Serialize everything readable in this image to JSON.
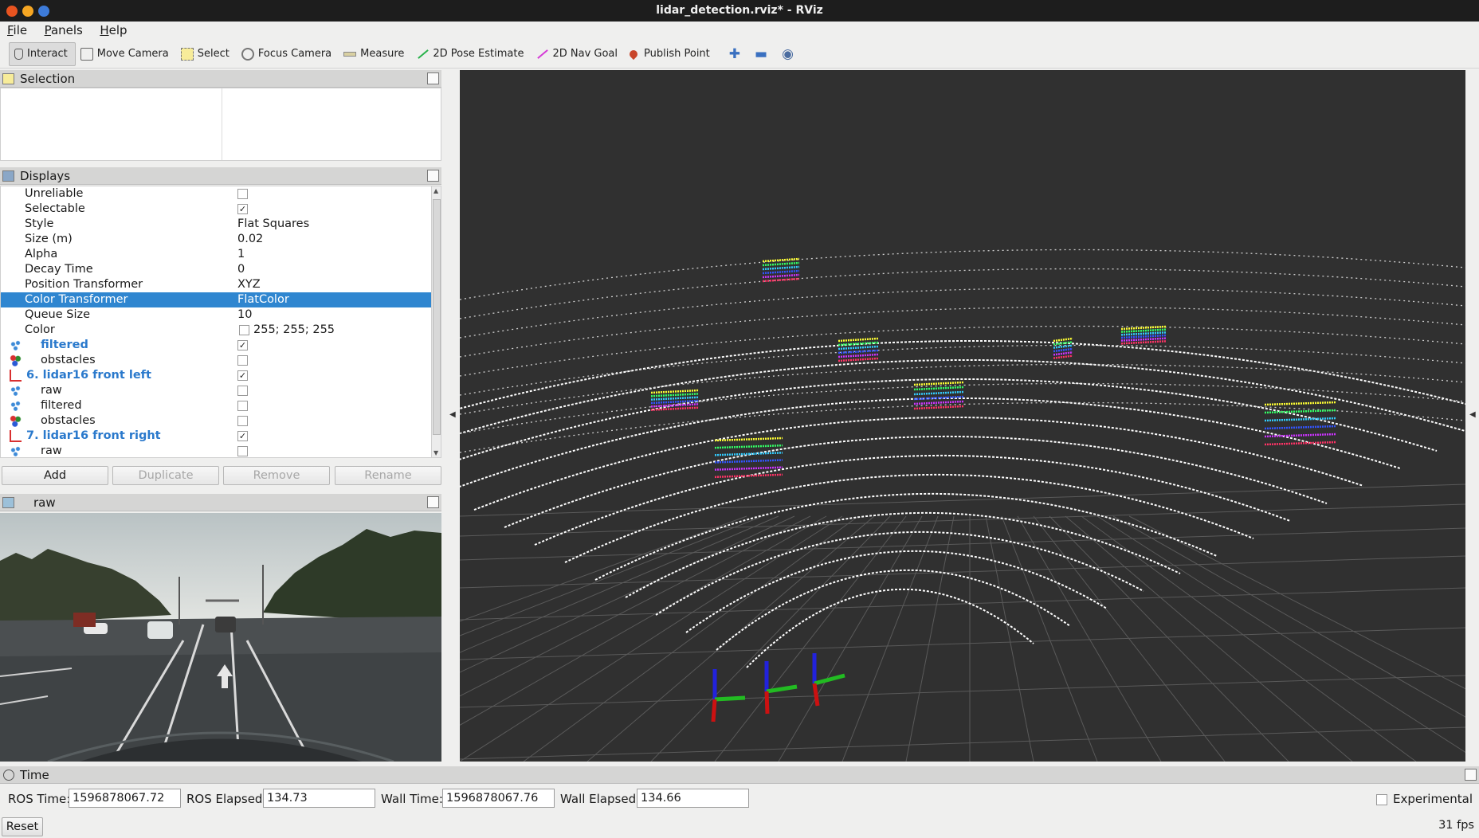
{
  "window": {
    "title": "lidar_detection.rviz* - RViz"
  },
  "menu": [
    "File",
    "Panels",
    "Help"
  ],
  "toolbar": {
    "tools": [
      {
        "label": "Interact",
        "icon": "hand-icon",
        "active": true
      },
      {
        "label": "Move Camera",
        "icon": "move-camera-icon"
      },
      {
        "label": "Select",
        "icon": "select-icon"
      },
      {
        "label": "Focus Camera",
        "icon": "focus-camera-icon"
      },
      {
        "label": "Measure",
        "icon": "measure-icon"
      },
      {
        "label": "2D Pose Estimate",
        "icon": "pose-arrow-icon"
      },
      {
        "label": "2D Nav Goal",
        "icon": "nav-goal-arrow-icon"
      },
      {
        "label": "Publish Point",
        "icon": "publish-point-icon"
      }
    ]
  },
  "selection_panel": {
    "title": "Selection"
  },
  "displays_panel": {
    "title": "Displays",
    "rows": [
      {
        "key": "Unreliable",
        "checkbox": false
      },
      {
        "key": "Selectable",
        "checkbox": true
      },
      {
        "key": "Style",
        "value": "Flat Squares"
      },
      {
        "key": "Size (m)",
        "value": "0.02"
      },
      {
        "key": "Alpha",
        "value": "1"
      },
      {
        "key": "Decay Time",
        "value": "0"
      },
      {
        "key": "Position Transformer",
        "value": "XYZ"
      },
      {
        "key": "Color Transformer",
        "value": "FlatColor",
        "selected": true
      },
      {
        "key": "Queue Size",
        "value": "10"
      },
      {
        "key": "Color",
        "value": "255; 255; 255",
        "swatch": "#ffffff"
      },
      {
        "key": "filtered",
        "icon": "point-cloud-icon",
        "checkbox": true,
        "highlight": true
      },
      {
        "key": "obstacles",
        "icon": "marker-icon",
        "checkbox": false
      },
      {
        "key": "6. lidar16 front left",
        "icon": "tf-axes-icon",
        "checkbox": true,
        "group": true
      },
      {
        "key": "raw",
        "icon": "point-cloud-icon",
        "checkbox": false
      },
      {
        "key": "filtered",
        "icon": "point-cloud-icon",
        "checkbox": false
      },
      {
        "key": "obstacles",
        "icon": "marker-icon",
        "checkbox": false
      },
      {
        "key": "7. lidar16 front right",
        "icon": "tf-axes-icon",
        "checkbox": true,
        "group": true
      },
      {
        "key": "raw",
        "icon": "point-cloud-icon",
        "checkbox": false
      }
    ],
    "buttons": [
      "Add",
      "Duplicate",
      "Remove",
      "Rename"
    ]
  },
  "image_panel": {
    "title": "raw"
  },
  "time_panel": {
    "title": "Time",
    "ros_time_label": "ROS Time:",
    "ros_time": "1596878067.72",
    "ros_elapsed_label": "ROS Elapsed:",
    "ros_elapsed": "134.73",
    "wall_time_label": "Wall Time:",
    "wall_time": "1596878067.76",
    "wall_elapsed_label": "Wall Elapsed:",
    "wall_elapsed": "134.66",
    "experimental_label": "Experimental",
    "reset_label": "Reset",
    "fps": "31 fps"
  },
  "colors": {
    "view_background": "#303030",
    "selected_row": "#2f86d0",
    "group_label": "#2a79cc",
    "grid": "#5a5a5a",
    "points": "#ffffff"
  }
}
